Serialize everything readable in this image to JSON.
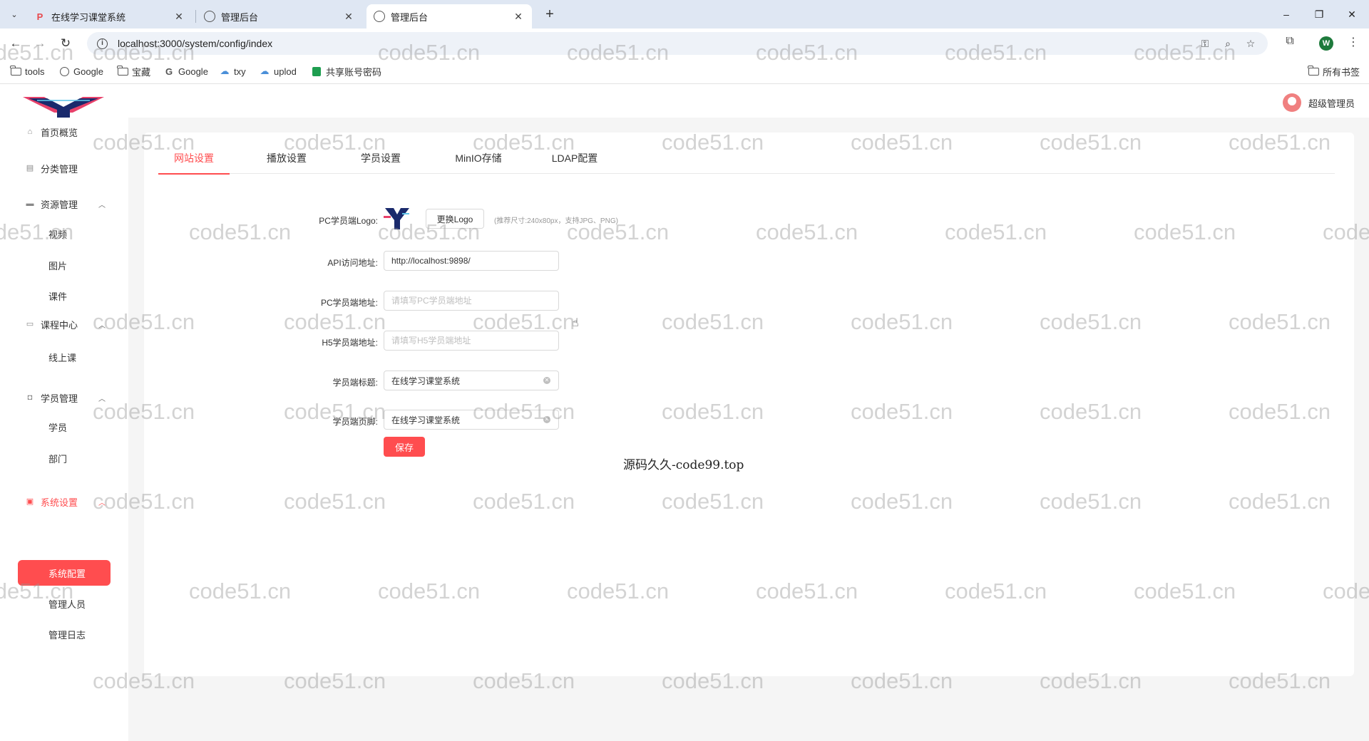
{
  "browser": {
    "tabs": [
      {
        "title": "在线学习课堂系统",
        "favicon": "play-icon"
      },
      {
        "title": "管理后台",
        "favicon": "globe-icon"
      },
      {
        "title": "管理后台",
        "favicon": "globe-icon",
        "active": true
      }
    ],
    "url": "localhost:3000/system/config/index",
    "bookmarks": [
      {
        "label": "tools",
        "icon": "folder-icon"
      },
      {
        "label": "Google",
        "icon": "globe-icon"
      },
      {
        "label": "宝藏",
        "icon": "folder-icon"
      },
      {
        "label": "Google",
        "icon": "google-icon"
      },
      {
        "label": "txy",
        "icon": "cloud-icon"
      },
      {
        "label": "uplod",
        "icon": "cloud-icon"
      },
      {
        "label": "共享账号密码",
        "icon": "sheet-icon"
      }
    ],
    "all_bookmarks": "所有书签",
    "profile_initial": "W"
  },
  "header": {
    "user_name": "超级管理员"
  },
  "sidebar": {
    "items": [
      {
        "label": "首页概览",
        "icon": "home-icon"
      },
      {
        "label": "分类管理",
        "icon": "category-icon"
      },
      {
        "label": "资源管理",
        "icon": "folder-icon",
        "children": [
          "视频",
          "图片",
          "课件"
        ]
      },
      {
        "label": "课程中心",
        "icon": "course-icon",
        "children": [
          "线上课"
        ]
      },
      {
        "label": "学员管理",
        "icon": "user-icon",
        "children": [
          "学员",
          "部门"
        ]
      },
      {
        "label": "系统设置",
        "icon": "settings-icon",
        "active": true,
        "children": [
          "系统配置",
          "管理人员",
          "管理日志"
        ]
      }
    ]
  },
  "tabs": [
    "网站设置",
    "播放设置",
    "学员设置",
    "MinIO存储",
    "LDAP配置"
  ],
  "form": {
    "logo_label": "PC学员端Logo:",
    "change_logo": "更换Logo",
    "logo_hint": "(推荐尺寸:240x80px，支持JPG、PNG)",
    "api_label": "API访问地址:",
    "api_value": "http://localhost:9898/",
    "pc_label": "PC学员端地址:",
    "pc_placeholder": "请填写PC学员端地址",
    "h5_label": "H5学员端地址:",
    "h5_placeholder": "请填写H5学员端地址",
    "title_label": "学员端标题:",
    "title_value": "在线学习课堂系统",
    "footer_label": "学员端页脚:",
    "footer_value": "在线学习课堂系统",
    "save": "保存"
  },
  "notice": "源码久久-code99.top",
  "watermark": "code51.cn",
  "colors": {
    "accent": "#ff4d4f"
  }
}
